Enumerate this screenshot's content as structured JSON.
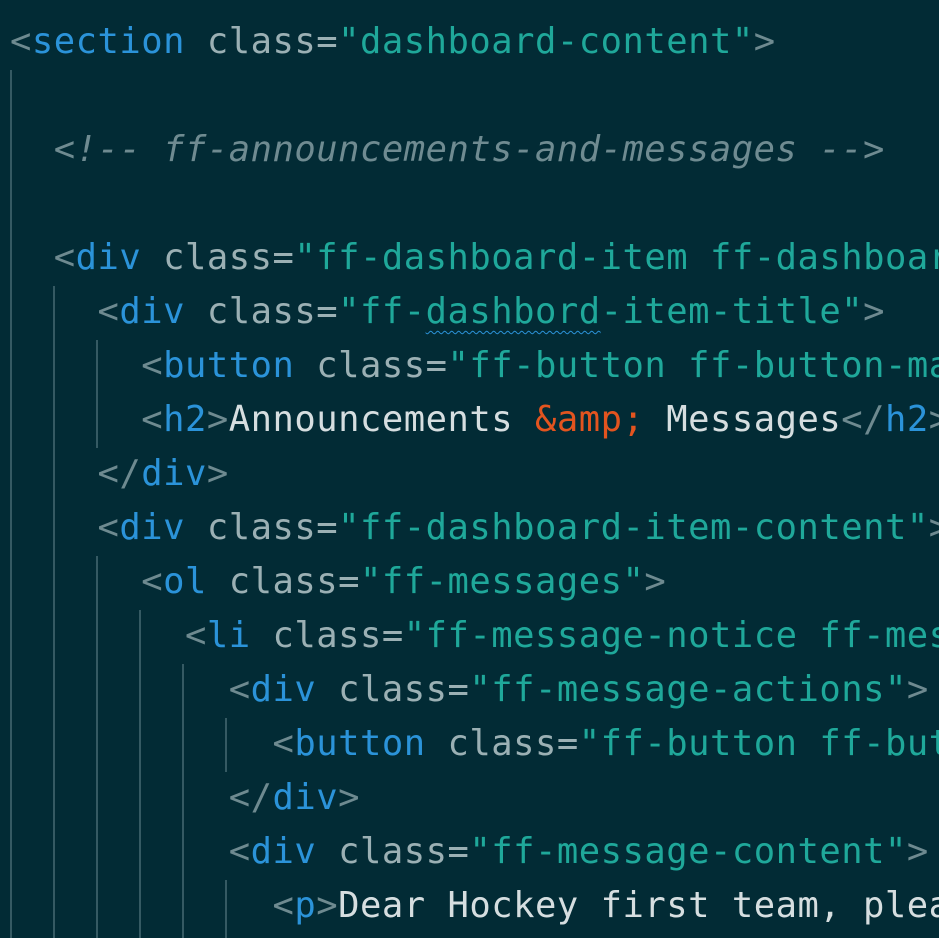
{
  "lines": [
    {
      "id": "l1",
      "parts": [
        {
          "c": "punct",
          "t": "<"
        },
        {
          "c": "tag",
          "t": "section"
        },
        {
          "c": "attr",
          "t": " class"
        },
        {
          "c": "eq",
          "t": "="
        },
        {
          "c": "str",
          "t": "\"dashboard-content\""
        },
        {
          "c": "punct",
          "t": ">"
        }
      ]
    },
    {
      "id": "l3",
      "parts": [
        {
          "c": "comment",
          "t": "  <!-- ff-announcements-and-messages -->"
        }
      ]
    },
    {
      "id": "l5",
      "parts": [
        {
          "c": "punct",
          "t": "  <"
        },
        {
          "c": "tag",
          "t": "div"
        },
        {
          "c": "attr",
          "t": " class"
        },
        {
          "c": "eq",
          "t": "="
        },
        {
          "c": "str",
          "t": "\"ff-dashboard-item ff-dashboar"
        }
      ]
    },
    {
      "id": "l6",
      "parts": [
        {
          "c": "punct",
          "t": "    <"
        },
        {
          "c": "tag",
          "t": "div"
        },
        {
          "c": "attr",
          "t": " class"
        },
        {
          "c": "eq",
          "t": "="
        },
        {
          "c": "str",
          "t": "\"ff-"
        },
        {
          "c": "str squiggle",
          "t": "dashbord"
        },
        {
          "c": "str",
          "t": "-item-title\""
        },
        {
          "c": "punct",
          "t": ">"
        }
      ]
    },
    {
      "id": "l7",
      "parts": [
        {
          "c": "punct",
          "t": "      <"
        },
        {
          "c": "tag",
          "t": "button"
        },
        {
          "c": "attr",
          "t": " class"
        },
        {
          "c": "eq",
          "t": "="
        },
        {
          "c": "str",
          "t": "\"ff-button ff-button-ma"
        }
      ]
    },
    {
      "id": "l8",
      "parts": [
        {
          "c": "punct",
          "t": "      <"
        },
        {
          "c": "tag",
          "t": "h2"
        },
        {
          "c": "punct",
          "t": ">"
        },
        {
          "c": "text",
          "t": "Announcements "
        },
        {
          "c": "ent",
          "t": "&amp;"
        },
        {
          "c": "text",
          "t": " Messages"
        },
        {
          "c": "punct",
          "t": "</"
        },
        {
          "c": "tag",
          "t": "h2"
        },
        {
          "c": "punct",
          "t": ">"
        }
      ]
    },
    {
      "id": "l9",
      "parts": [
        {
          "c": "punct",
          "t": "    </"
        },
        {
          "c": "tag",
          "t": "div"
        },
        {
          "c": "punct",
          "t": ">"
        }
      ]
    },
    {
      "id": "l10",
      "parts": [
        {
          "c": "punct",
          "t": "    <"
        },
        {
          "c": "tag",
          "t": "div"
        },
        {
          "c": "attr",
          "t": " class"
        },
        {
          "c": "eq",
          "t": "="
        },
        {
          "c": "str",
          "t": "\"ff-dashboard-item-content\""
        },
        {
          "c": "punct",
          "t": ">"
        }
      ]
    },
    {
      "id": "l11",
      "parts": [
        {
          "c": "punct",
          "t": "      <"
        },
        {
          "c": "tag",
          "t": "ol"
        },
        {
          "c": "attr",
          "t": " class"
        },
        {
          "c": "eq",
          "t": "="
        },
        {
          "c": "str",
          "t": "\"ff-messages\""
        },
        {
          "c": "punct",
          "t": ">"
        }
      ]
    },
    {
      "id": "l12",
      "parts": [
        {
          "c": "punct",
          "t": "        <"
        },
        {
          "c": "tag",
          "t": "li"
        },
        {
          "c": "attr",
          "t": " class"
        },
        {
          "c": "eq",
          "t": "="
        },
        {
          "c": "str",
          "t": "\"ff-message-notice ff-mes"
        }
      ]
    },
    {
      "id": "l13",
      "parts": [
        {
          "c": "punct",
          "t": "          <"
        },
        {
          "c": "tag",
          "t": "div"
        },
        {
          "c": "attr",
          "t": " class"
        },
        {
          "c": "eq",
          "t": "="
        },
        {
          "c": "str",
          "t": "\"ff-message-actions\""
        },
        {
          "c": "punct",
          "t": ">"
        }
      ]
    },
    {
      "id": "l14",
      "parts": [
        {
          "c": "punct",
          "t": "            <"
        },
        {
          "c": "tag",
          "t": "button"
        },
        {
          "c": "attr",
          "t": " class"
        },
        {
          "c": "eq",
          "t": "="
        },
        {
          "c": "str",
          "t": "\"ff-button ff-but"
        }
      ]
    },
    {
      "id": "l15",
      "parts": [
        {
          "c": "punct",
          "t": "          </"
        },
        {
          "c": "tag",
          "t": "div"
        },
        {
          "c": "punct",
          "t": ">"
        }
      ]
    },
    {
      "id": "l16",
      "parts": [
        {
          "c": "punct",
          "t": "          <"
        },
        {
          "c": "tag",
          "t": "div"
        },
        {
          "c": "attr",
          "t": " class"
        },
        {
          "c": "eq",
          "t": "="
        },
        {
          "c": "str",
          "t": "\"ff-message-content\""
        },
        {
          "c": "punct",
          "t": ">"
        }
      ]
    },
    {
      "id": "l17",
      "parts": [
        {
          "c": "punct",
          "t": "            <"
        },
        {
          "c": "tag",
          "t": "p"
        },
        {
          "c": "punct",
          "t": ">"
        },
        {
          "c": "text",
          "t": "Dear Hockey first team, plea"
        }
      ]
    }
  ],
  "colors": {
    "background": "#022b35",
    "tag": "#2b93d9",
    "string": "#1fa89a",
    "entity": "#e3541f",
    "comment": "#6f8b91",
    "text": "#d6dee0",
    "guide": "#355a63"
  }
}
